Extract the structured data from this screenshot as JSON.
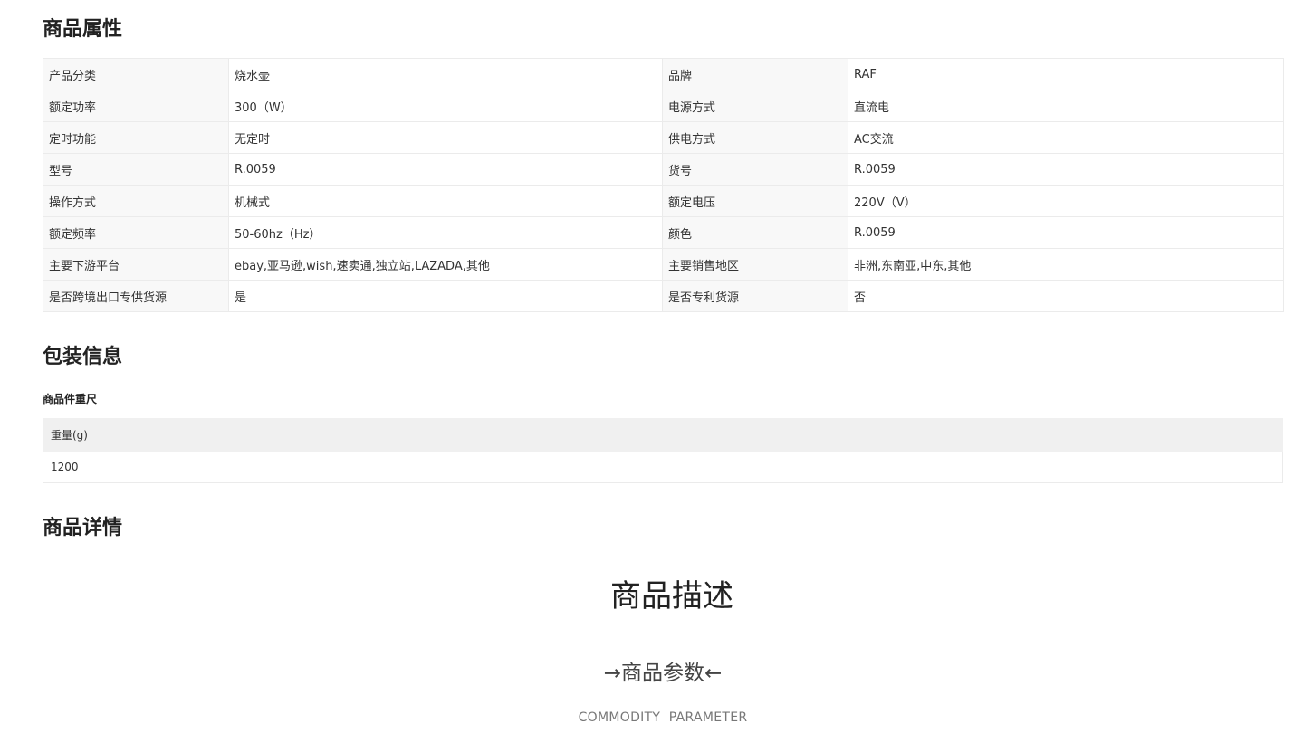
{
  "sections": {
    "attributes_title": "商品属性",
    "packaging_title": "包装信息",
    "detail_title": "商品详情"
  },
  "attributes": [
    [
      "产品分类",
      "烧水壶",
      "品牌",
      "RAF"
    ],
    [
      "额定功率",
      "300（W）",
      "电源方式",
      "直流电"
    ],
    [
      "定时功能",
      "无定时",
      "供电方式",
      "AC交流"
    ],
    [
      "型号",
      "R.0059",
      "货号",
      "R.0059"
    ],
    [
      "操作方式",
      "机械式",
      "额定电压",
      "220V（V）"
    ],
    [
      "额定频率",
      "50-60hz（Hz）",
      "颜色",
      "R.0059"
    ],
    [
      "主要下游平台",
      "ebay,亚马逊,wish,速卖通,独立站,LAZADA,其他",
      "主要销售地区",
      "非洲,东南亚,中东,其他"
    ],
    [
      "是否跨境出口专供货源",
      "是",
      "是否专利货源",
      "否"
    ]
  ],
  "packaging": {
    "subtitle": "商品件重尺",
    "header": "重量(g)",
    "value": "1200"
  },
  "detail": {
    "heading": "商品描述",
    "param_title": "→商品参数←",
    "param_subtitle": "COMMODITY  PARAMETER"
  }
}
